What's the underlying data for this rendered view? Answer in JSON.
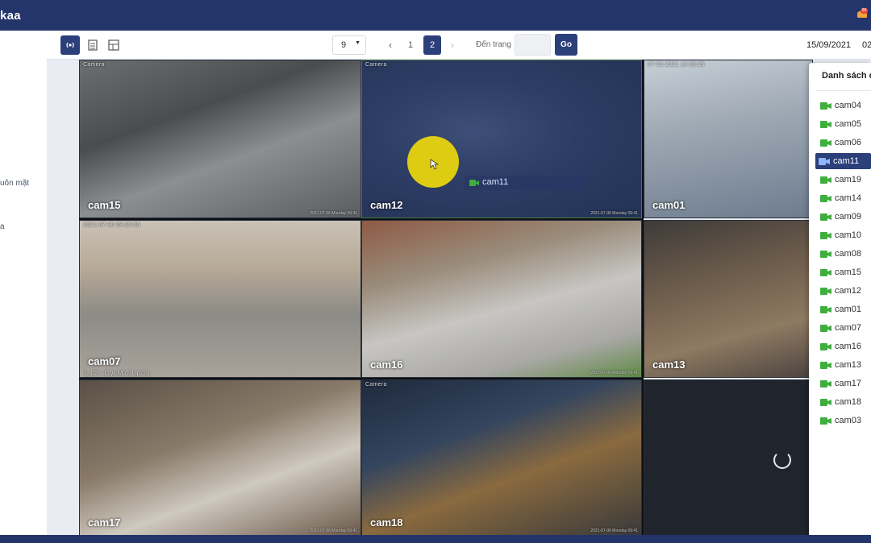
{
  "header": {
    "brand": "kaa",
    "notif_count": "99"
  },
  "sidebar": {
    "items": [
      {
        "label": "uôn mặt"
      },
      {
        "label": "a"
      }
    ]
  },
  "toolbar": {
    "per_page": "9",
    "pages": [
      "1",
      "2"
    ],
    "active_page": "2",
    "prev": "‹",
    "next": "›",
    "goto_label": "Đến trang",
    "goto_value": "",
    "go_label": "Go",
    "date": "15/09/2021",
    "time": "02"
  },
  "grid": {
    "cells": [
      {
        "label": "cam15",
        "osd": "Camera",
        "osd2": "2021-07-06 Monday 09:41"
      },
      {
        "label": "cam12",
        "osd": "Camera",
        "osd2": "2021-07-06 Monday 09:41"
      },
      {
        "label": "cam01",
        "osd": "07-02-2021 14 09:35",
        "osd2": ""
      },
      {
        "label": "cam07",
        "osd": "2021-07-30 09:25:56",
        "osd2": ""
      },
      {
        "label": "cam16",
        "osd": "",
        "osd2": "2021-07-06 Monday 09:41"
      },
      {
        "label": "cam13",
        "osd": "",
        "osd2": ""
      },
      {
        "label": "cam17",
        "osd": "",
        "osd2": "2021-07-06 Monday 09:41"
      },
      {
        "label": "cam18",
        "osd": "Camera",
        "osd2": "2021-07-06 Monday 09:41"
      },
      {
        "label": "",
        "osd": "",
        "osd2": ""
      }
    ],
    "extra_osd_cam07": "L I 2 - C A M 0 1 ( 0 )",
    "drag_ghost": "cam11"
  },
  "camera_panel": {
    "title": "Danh sách c",
    "items": [
      "cam04",
      "cam05",
      "cam06",
      "cam11",
      "cam19",
      "cam14",
      "cam09",
      "cam10",
      "cam08",
      "cam15",
      "cam12",
      "cam01",
      "cam07",
      "cam16",
      "cam13",
      "cam17",
      "cam18",
      "cam03"
    ],
    "selected": "cam11"
  },
  "colors": {
    "primary": "#2b3f7a",
    "header": "#24356b",
    "status_green": "#3fae3f",
    "cursor": "#e8d40f"
  }
}
